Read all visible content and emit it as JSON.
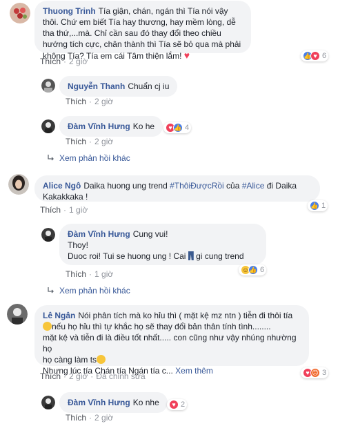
{
  "colors": {
    "link": "#385898",
    "meta": "#90949c",
    "bubble": "#f2f3f5",
    "like": "#4a7fe8",
    "love": "#f0405a"
  },
  "c1": {
    "author": "Thuong Trinh",
    "text": "Tía giận, chán, ngán thì Tía nói vậy thôi. Chứ em biết Tía hay thương, hay mềm lòng, dễ tha thứ,...mà. Chỉ cần sau đó thay đổi theo chiều hướng tích cực, chân thành thì Tía sẽ bỏ qua mà phải không Tía? Tía em cái Tâm thiện lắm!",
    "like_label": "Thích",
    "time": "2 giờ",
    "reaction_count": "6",
    "reaction_icons": [
      "like-icon",
      "love-icon"
    ]
  },
  "r1": {
    "author": "Nguyễn Thanh",
    "text": "Chuẩn cj iu",
    "like_label": "Thích",
    "time": "2 giờ"
  },
  "r2": {
    "author": "Đàm Vĩnh Hưng",
    "text": "Ko he",
    "like_label": "Thích",
    "time": "2 giờ",
    "reaction_count": "4",
    "reaction_icons": [
      "love-icon",
      "like-icon"
    ]
  },
  "more1": {
    "label": "Xem phản hồi khác"
  },
  "c2": {
    "author": "Alice Ngô",
    "text_before": "Daika huong ung trend ",
    "hashtag1": "#ThôiĐượcRồi",
    "text_mid": " của ",
    "hashtag2": "#Alice",
    "text_after": " đi Daika Kakakkaka !",
    "like_label": "Thích",
    "time": "1 giờ",
    "reaction_count": "1",
    "reaction_icons": [
      "like-icon"
    ]
  },
  "r3": {
    "author": "Đàm Vĩnh Hưng",
    "line1": "Cung vui!",
    "line2": "Thoy!",
    "line3_before": "Duoc roi! Tui se huong ung ! Cai ",
    "line3_after": " gi cung trend",
    "like_label": "Thích",
    "time": "1 giờ",
    "reaction_count": "6",
    "reaction_icons": [
      "haha-icon",
      "like-icon"
    ]
  },
  "more2": {
    "label": "Xem phản hồi khác"
  },
  "c3": {
    "author": "Lê Ngân",
    "text1": "Nói phân tích mà ko hỉu thì ( mặt kệ mz ntn ) tiễn đi thôi tía",
    "text2": "nếu họ hỉu thì tự khắc họ sẽ thay đổi bản thân tính tình........",
    "text3": "mặt kệ và tiễn đi là điều tốt nhất..... con cũng như vậy nhúng nhường họ",
    "text4": "họ càng làm ts",
    "text5": "Nhưng lúc tía Chán tía Ngán tía c...",
    "see_more": "Xem thêm",
    "like_label": "Thích",
    "time": "2 giờ",
    "edited": "Đã chỉnh sửa",
    "reaction_count": "3",
    "reaction_icons": [
      "love-icon",
      "angry-icon"
    ]
  },
  "r4": {
    "author": "Đàm Vĩnh Hưng",
    "text": "Ko nhe",
    "like_label": "Thích",
    "time": "2 giờ",
    "reaction_count": "2",
    "reaction_icons": [
      "love-icon"
    ]
  }
}
